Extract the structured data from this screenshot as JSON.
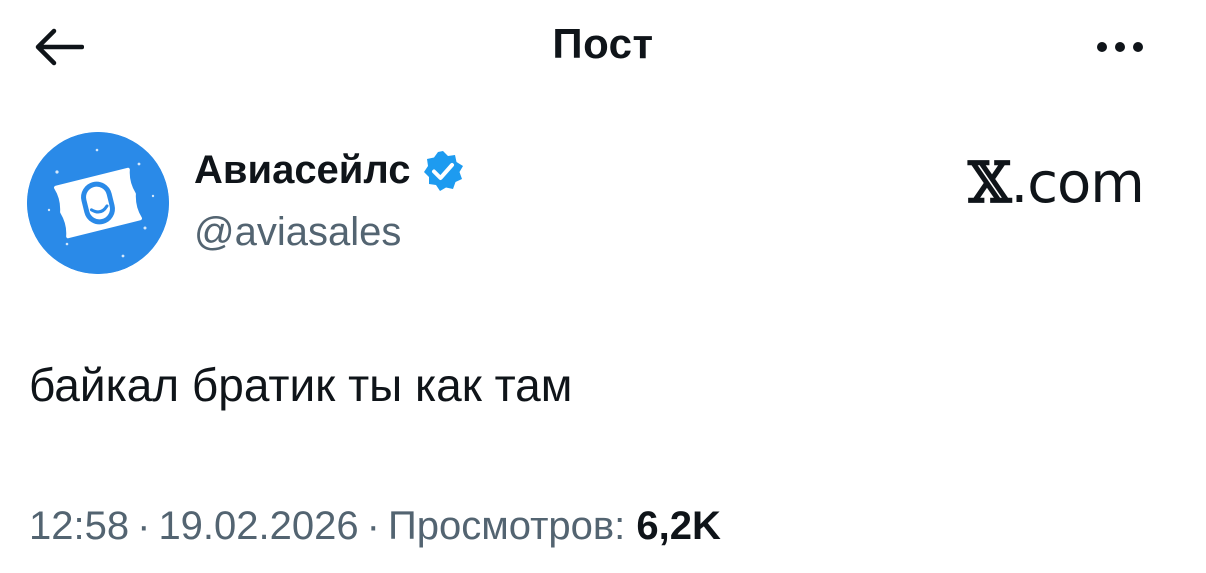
{
  "header": {
    "title": "Пост",
    "back_icon": "arrow-left-icon",
    "more_icon": "more-horizontal-icon"
  },
  "author": {
    "name": "Авиасейлс",
    "handle": "@aviasales",
    "verified": true,
    "verified_color": "#1d9bf0",
    "avatar_color": "#2a8ae8"
  },
  "watermark": {
    "x_letter": "𝕏",
    "suffix": ".com"
  },
  "post": {
    "text": "байкал братик ты как там"
  },
  "meta": {
    "time": "12:58",
    "separator": "·",
    "date": "19.02.2026",
    "views_label": "Просмотров:",
    "views_count": "6,2K"
  },
  "colors": {
    "text_primary": "#0f1419",
    "text_secondary": "#536471",
    "background": "#ffffff"
  }
}
